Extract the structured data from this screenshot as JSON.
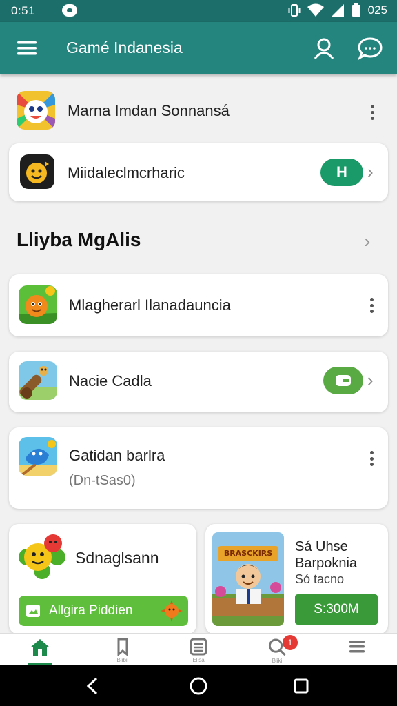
{
  "statusbar": {
    "time": "0:51",
    "battery": "025"
  },
  "appbar": {
    "title": "Gamé Indanesia"
  },
  "items": [
    {
      "title": "Marna Imdan Sonnansá"
    },
    {
      "title": "Miidaleclmcrharic",
      "button_label": "H"
    }
  ],
  "section": {
    "title": "Lliyba MgAlis"
  },
  "section_items": [
    {
      "title": "Mlagherarl Ilanadauncia"
    },
    {
      "title": "Nacie Cadla"
    },
    {
      "title": "Gatidan barlra",
      "subtitle": "(Dn-tSas0)"
    }
  ],
  "promos": [
    {
      "title": "Sdnaglsann",
      "button_label": "Allgira Piddien"
    },
    {
      "banner_text": "BRASCKIRS",
      "line1": "Sá Uhse",
      "line2": "Barpoknia",
      "line3": "Só tacno",
      "price": "S:300M"
    }
  ],
  "bottom_nav": [
    {
      "label": ""
    },
    {
      "label": "Blibil"
    },
    {
      "label": "Elisa"
    },
    {
      "label": "Bliki"
    },
    {
      "label": ""
    }
  ],
  "bottom_nav_badge": "1",
  "colors": {
    "teal_dark": "#1c6e6a",
    "teal": "#24857f",
    "green_pill": "#1a9a68",
    "green_pill2": "#5aaa44",
    "badge": "#e53935"
  }
}
